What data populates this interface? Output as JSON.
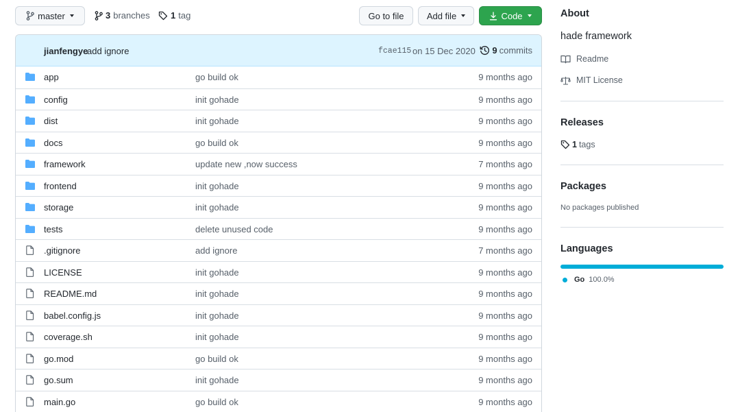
{
  "toolbar": {
    "branch_label": "master",
    "branches_count": "3",
    "branches_label": "branches",
    "tags_count": "1",
    "tags_label": "tag",
    "goto_file_label": "Go to file",
    "add_file_label": "Add file",
    "code_label": "Code"
  },
  "commit": {
    "author": "jianfengye",
    "message": "add ignore",
    "sha": "fcae115",
    "date": "on 15 Dec 2020",
    "count": "9",
    "count_label": "commits"
  },
  "files": [
    {
      "type": "dir",
      "name": "app",
      "message": "go build ok",
      "age": "9 months ago"
    },
    {
      "type": "dir",
      "name": "config",
      "message": "init gohade",
      "age": "9 months ago"
    },
    {
      "type": "dir",
      "name": "dist",
      "message": "init gohade",
      "age": "9 months ago"
    },
    {
      "type": "dir",
      "name": "docs",
      "message": "go build ok",
      "age": "9 months ago"
    },
    {
      "type": "dir",
      "name": "framework",
      "message": "update new ,now success",
      "age": "7 months ago"
    },
    {
      "type": "dir",
      "name": "frontend",
      "message": "init gohade",
      "age": "9 months ago"
    },
    {
      "type": "dir",
      "name": "storage",
      "message": "init gohade",
      "age": "9 months ago"
    },
    {
      "type": "dir",
      "name": "tests",
      "message": "delete unused code",
      "age": "9 months ago"
    },
    {
      "type": "file",
      "name": ".gitignore",
      "message": "add ignore",
      "age": "7 months ago"
    },
    {
      "type": "file",
      "name": "LICENSE",
      "message": "init gohade",
      "age": "9 months ago"
    },
    {
      "type": "file",
      "name": "README.md",
      "message": "init gohade",
      "age": "9 months ago"
    },
    {
      "type": "file",
      "name": "babel.config.js",
      "message": "init gohade",
      "age": "9 months ago"
    },
    {
      "type": "file",
      "name": "coverage.sh",
      "message": "init gohade",
      "age": "9 months ago"
    },
    {
      "type": "file",
      "name": "go.mod",
      "message": "go build ok",
      "age": "9 months ago"
    },
    {
      "type": "file",
      "name": "go.sum",
      "message": "init gohade",
      "age": "9 months ago"
    },
    {
      "type": "file",
      "name": "main.go",
      "message": "go build ok",
      "age": "9 months ago"
    }
  ],
  "sidebar": {
    "about_title": "About",
    "description": "hade framework",
    "readme_label": "Readme",
    "license_label": "MIT License",
    "releases_title": "Releases",
    "release_tags_count": "1",
    "release_tags_label": "tags",
    "packages_title": "Packages",
    "packages_text": "No packages published",
    "languages_title": "Languages",
    "language_name": "Go",
    "language_percent": "100.0%",
    "language_fraction": 1.0
  },
  "colors": {
    "accent_green": "#2da44e",
    "folder_blue": "#54aeff",
    "go_lang": "#00add8",
    "commit_bar_bg": "#ddf4ff"
  },
  "icons": {
    "branch": "git-branch-icon",
    "tag": "tag-icon",
    "history": "history-icon",
    "folder": "folder-icon",
    "file": "file-icon",
    "book": "book-icon",
    "law": "law-icon",
    "download": "download-icon"
  }
}
